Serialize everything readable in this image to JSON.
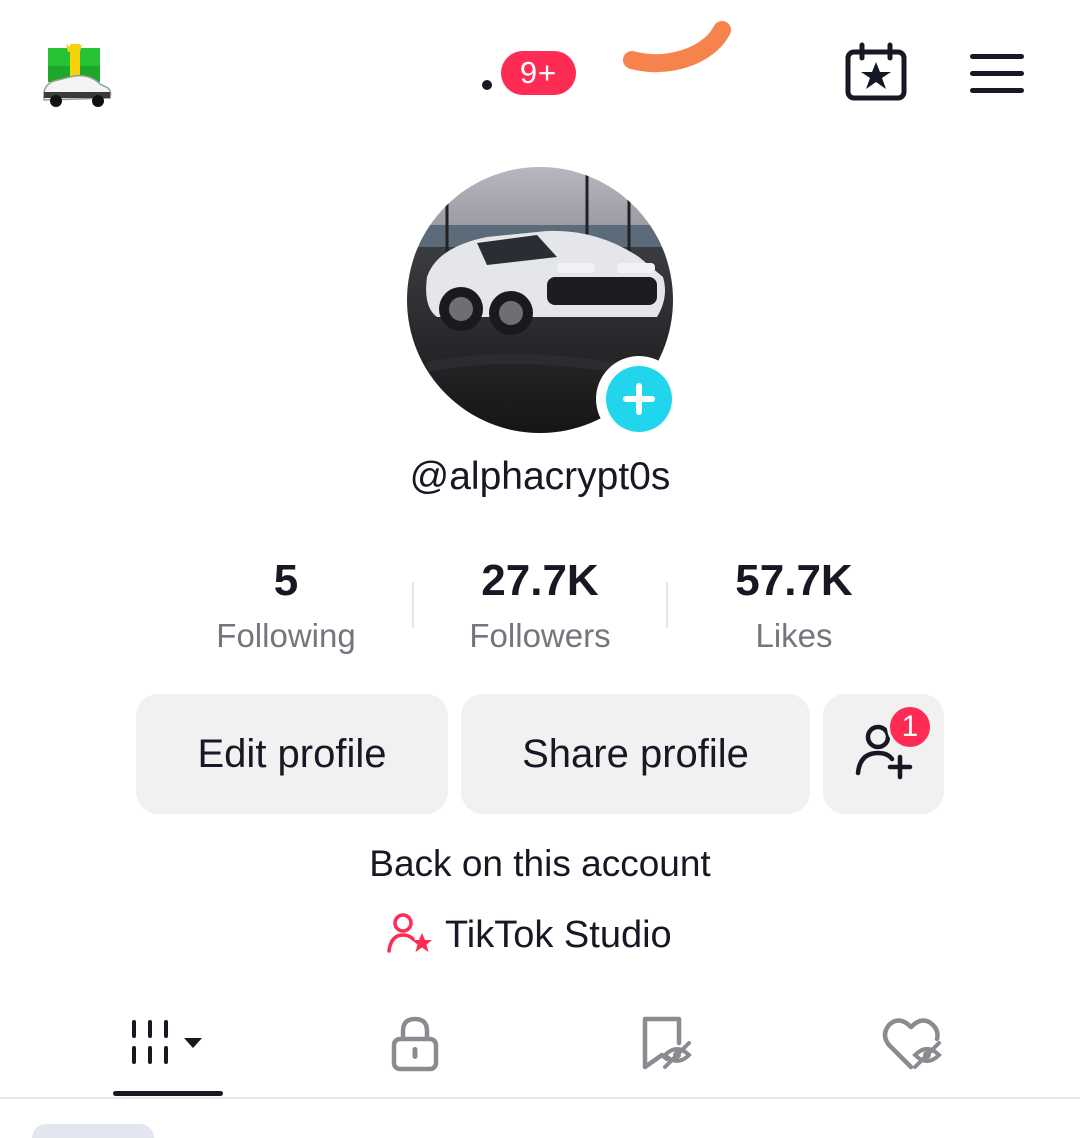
{
  "topbar": {
    "gift_icon": "gift-car-icon",
    "notification_count": "9+",
    "calendar_icon": "calendar-star-icon",
    "menu_icon": "hamburger-menu-icon"
  },
  "profile": {
    "avatar_description": "avatar-image",
    "username": "@alphacrypt0s"
  },
  "stats": [
    {
      "value": "5",
      "label": "Following"
    },
    {
      "value": "27.7K",
      "label": "Followers"
    },
    {
      "value": "57.7K",
      "label": "Likes"
    }
  ],
  "actions": {
    "edit_profile": "Edit profile",
    "share_profile": "Share profile",
    "add_friends_badge": "1"
  },
  "back_on_account": "Back on this account",
  "studio_label": "TikTok Studio",
  "tabs": [
    "videos-grid",
    "private",
    "reposts",
    "liked"
  ],
  "colors": {
    "accent_red": "#fe2c55",
    "cyan": "#20d5ec",
    "text": "#161823",
    "muted": "#75767d",
    "button_bg": "#f1f1f2"
  }
}
